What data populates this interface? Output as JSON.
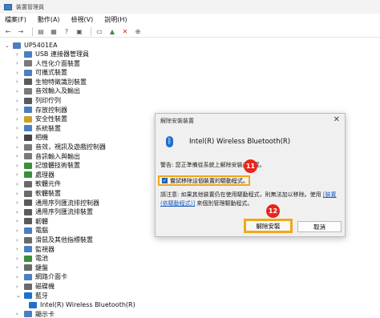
{
  "window": {
    "title": "裝置管理員"
  },
  "menu": [
    "檔案(F)",
    "動作(A)",
    "檢視(V)",
    "說明(H)"
  ],
  "toolbar_icons": [
    "back-arrow-icon",
    "forward-arrow-icon",
    "properties-icon",
    "tree-icon",
    "help-icon",
    "device-icon",
    "scan-icon",
    "add-device-icon",
    "remove-x-icon",
    "download-icon"
  ],
  "tree": {
    "root": "UP5401EA",
    "items": [
      {
        "label": "USB 連接器管理員",
        "color": "#4a7fc1"
      },
      {
        "label": "人性化介面裝置",
        "color": "#7a7a7a"
      },
      {
        "label": "可攜式裝置",
        "color": "#4a7fc1"
      },
      {
        "label": "生物特徵識別裝置",
        "color": "#5a5a5a"
      },
      {
        "label": "音效輸入及輸出",
        "color": "#7a7a7a"
      },
      {
        "label": "列印佇列",
        "color": "#5a5a5a"
      },
      {
        "label": "存放控制器",
        "color": "#4a7fc1"
      },
      {
        "label": "安全性裝置",
        "color": "#c9a227"
      },
      {
        "label": "系統裝置",
        "color": "#4a7fc1"
      },
      {
        "label": "相機",
        "color": "#444444"
      },
      {
        "label": "音效，視訊及遊戲控制器",
        "color": "#7a7a7a"
      },
      {
        "label": "音訊輸入與輸出",
        "color": "#7a7a7a"
      },
      {
        "label": "記憶體技術裝置",
        "color": "#3a8f3a"
      },
      {
        "label": "處理器",
        "color": "#3a8f3a"
      },
      {
        "label": "軟體元件",
        "color": "#6a6a6a"
      },
      {
        "label": "軟體裝置",
        "color": "#6a6a6a"
      },
      {
        "label": "通用序列匯流排控制器",
        "color": "#5a5a5a"
      },
      {
        "label": "通用序列匯流排裝置",
        "color": "#5a5a5a"
      },
      {
        "label": "韌體",
        "color": "#5a5a5a"
      },
      {
        "label": "電腦",
        "color": "#4a7fc1"
      },
      {
        "label": "滑鼠及其他指標裝置",
        "color": "#6a6a6a"
      },
      {
        "label": "監視器",
        "color": "#4a7fc1"
      },
      {
        "label": "電池",
        "color": "#3a8f3a"
      },
      {
        "label": "鍵盤",
        "color": "#6a6a6a"
      },
      {
        "label": "網路介面卡",
        "color": "#4a7fc1"
      },
      {
        "label": "磁碟機",
        "color": "#6a6a6a"
      }
    ],
    "bluetooth": {
      "label": "藍牙",
      "child": "Intel(R) Wireless Bluetooth(R)"
    },
    "last": {
      "label": "顯示卡",
      "color": "#4a7fc1"
    }
  },
  "dialog": {
    "title": "解除安裝裝置",
    "device_name": "Intel(R) Wireless Bluetooth(R)",
    "warning": "警告: 您正準備從系統上解除安裝此裝置。",
    "checkbox_label": "嘗試移除這個裝置的驅動程式。",
    "checkbox_checked": true,
    "note_prefix": "請注意: 如果其他裝置仍在使用驅動程式，則無法加以移除。使用",
    "note_link": "[裝置 (依驅動程式)]",
    "note_suffix": " 來個別管理驅動程式。",
    "uninstall_label": "解除安裝",
    "cancel_label": "取消"
  },
  "markers": [
    "11",
    "12"
  ]
}
